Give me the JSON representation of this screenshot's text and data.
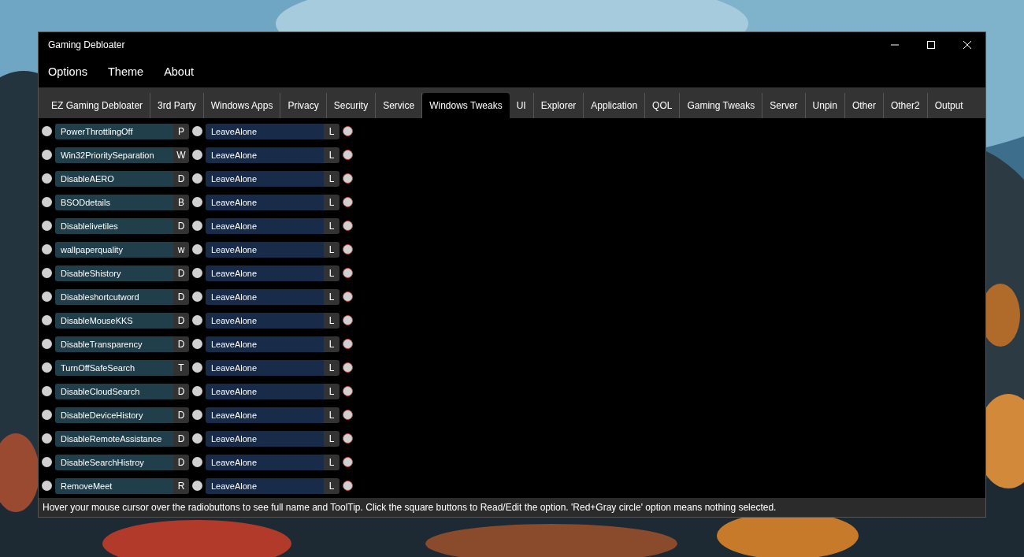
{
  "window": {
    "title": "Gaming Debloater"
  },
  "menu": [
    "Options",
    "Theme",
    "About"
  ],
  "tabs": [
    {
      "label": "EZ Gaming Debloater",
      "selected": false
    },
    {
      "label": "3rd Party",
      "selected": false
    },
    {
      "label": "Windows Apps",
      "selected": false
    },
    {
      "label": "Privacy",
      "selected": false
    },
    {
      "label": "Security",
      "selected": false
    },
    {
      "label": "Service",
      "selected": false
    },
    {
      "label": "Windows Tweaks",
      "selected": true
    },
    {
      "label": "UI",
      "selected": false
    },
    {
      "label": "Explorer",
      "selected": false
    },
    {
      "label": "Application",
      "selected": false
    },
    {
      "label": "QOL",
      "selected": false
    },
    {
      "label": "Gaming Tweaks",
      "selected": false
    },
    {
      "label": "Server",
      "selected": false
    },
    {
      "label": "Unpin",
      "selected": false
    },
    {
      "label": "Other",
      "selected": false
    },
    {
      "label": "Other2",
      "selected": false
    },
    {
      "label": "Output",
      "selected": false
    }
  ],
  "rows": [
    {
      "name": "PowerThrottlingOff",
      "key": "P",
      "option": "LeaveAlone",
      "option_key": "L",
      "name_selected": false,
      "option_selected": false,
      "none_selected": true
    },
    {
      "name": "Win32PrioritySeparation",
      "key": "W",
      "option": "LeaveAlone",
      "option_key": "L",
      "name_selected": false,
      "option_selected": false,
      "none_selected": true
    },
    {
      "name": "DisableAERO",
      "key": "D",
      "option": "LeaveAlone",
      "option_key": "L",
      "name_selected": false,
      "option_selected": false,
      "none_selected": true
    },
    {
      "name": "BSODdetails",
      "key": "B",
      "option": "LeaveAlone",
      "option_key": "L",
      "name_selected": false,
      "option_selected": false,
      "none_selected": true
    },
    {
      "name": "Disablelivetiles",
      "key": "D",
      "option": "LeaveAlone",
      "option_key": "L",
      "name_selected": false,
      "option_selected": false,
      "none_selected": true
    },
    {
      "name": "wallpaperquality",
      "key": "w",
      "option": "LeaveAlone",
      "option_key": "L",
      "name_selected": false,
      "option_selected": false,
      "none_selected": true
    },
    {
      "name": "DisableShistory",
      "key": "D",
      "option": "LeaveAlone",
      "option_key": "L",
      "name_selected": false,
      "option_selected": false,
      "none_selected": true
    },
    {
      "name": "Disableshortcutword",
      "key": "D",
      "option": "LeaveAlone",
      "option_key": "L",
      "name_selected": false,
      "option_selected": false,
      "none_selected": true
    },
    {
      "name": "DisableMouseKKS",
      "key": "D",
      "option": "LeaveAlone",
      "option_key": "L",
      "name_selected": false,
      "option_selected": false,
      "none_selected": true
    },
    {
      "name": "DisableTransparency",
      "key": "D",
      "option": "LeaveAlone",
      "option_key": "L",
      "name_selected": false,
      "option_selected": false,
      "none_selected": true
    },
    {
      "name": "TurnOffSafeSearch",
      "key": "T",
      "option": "LeaveAlone",
      "option_key": "L",
      "name_selected": false,
      "option_selected": false,
      "none_selected": true
    },
    {
      "name": "DisableCloudSearch",
      "key": "D",
      "option": "LeaveAlone",
      "option_key": "L",
      "name_selected": false,
      "option_selected": false,
      "none_selected": true
    },
    {
      "name": "DisableDeviceHistory",
      "key": "D",
      "option": "LeaveAlone",
      "option_key": "L",
      "name_selected": false,
      "option_selected": false,
      "none_selected": true
    },
    {
      "name": "DisableRemoteAssistance",
      "key": "D",
      "option": "LeaveAlone",
      "option_key": "L",
      "name_selected": false,
      "option_selected": false,
      "none_selected": true
    },
    {
      "name": "DisableSearchHistroy",
      "key": "D",
      "option": "LeaveAlone",
      "option_key": "L",
      "name_selected": false,
      "option_selected": false,
      "none_selected": true
    },
    {
      "name": "RemoveMeet",
      "key": "R",
      "option": "LeaveAlone",
      "option_key": "L",
      "name_selected": false,
      "option_selected": false,
      "none_selected": true
    }
  ],
  "status_bar": "Hover your mouse cursor over the radiobuttons to see full name and ToolTip. Click the square buttons to Read/Edit the option. 'Red+Gray circle' option means nothing selected."
}
